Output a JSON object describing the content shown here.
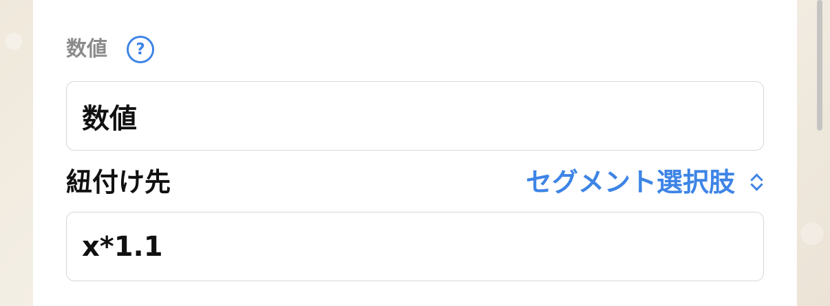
{
  "form": {
    "field_title": "数値",
    "help_icon": "question-circle-icon",
    "name_value": "数値",
    "mapping_label": "紐付け先",
    "segment_picker_label": "セグメント選択肢",
    "expression_value": "x*1.1"
  },
  "colors": {
    "accent": "#3d84e6",
    "text": "#111111",
    "muted_text": "#8b8b8b",
    "border": "#d7d7d7",
    "panel_background": "#ffffff",
    "page_background": "#f1ece2"
  }
}
